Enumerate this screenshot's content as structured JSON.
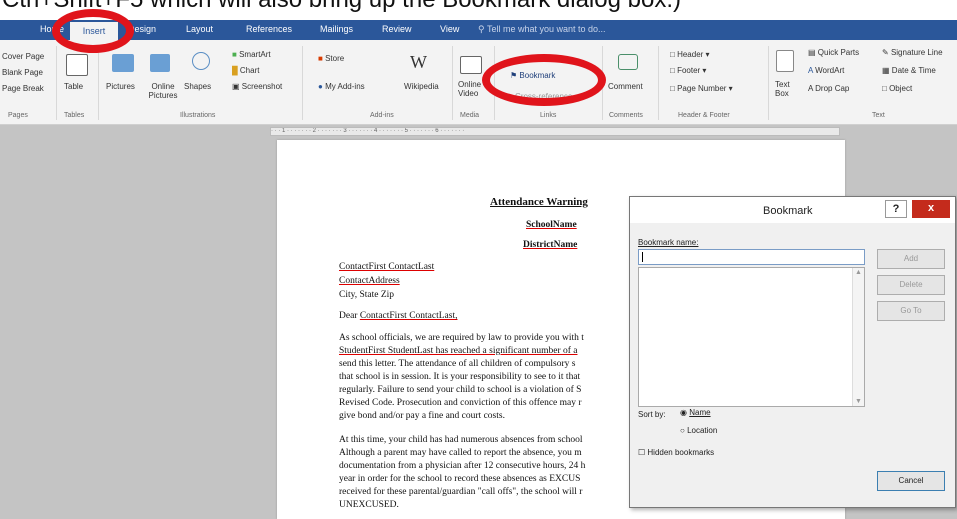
{
  "top_caption": "Ctrl+Shift+F5 which will also bring up the Bookmark dialog box.)",
  "tabs": [
    "Home",
    "Insert",
    "Design",
    "Layout",
    "References",
    "Mailings",
    "Review",
    "View"
  ],
  "tell_me": "Tell me what you want to do...",
  "ribbon": {
    "pages": [
      "Cover Page",
      "Blank Page",
      "Page Break"
    ],
    "table": "Table",
    "pictures": "Pictures",
    "online_pictures": "Online Pictures",
    "shapes": "Shapes",
    "smartart": "SmartArt",
    "chart": "Chart",
    "screenshot": "Screenshot",
    "store": "Store",
    "my_addins": "My Add-ins",
    "wikipedia": "Wikipedia",
    "online_video": "Online Video",
    "bookmark": "Bookmark",
    "cross_ref": "Cross-reference",
    "comment": "Comment",
    "header": "Header",
    "footer": "Footer",
    "page_number": "Page Number",
    "text_box": "Text Box",
    "quick_parts": "Quick Parts",
    "wordart": "WordArt",
    "drop_cap": "Drop Cap",
    "signature": "Signature Line",
    "date_time": "Date & Time",
    "object": "Object",
    "groups": [
      "Pages",
      "Tables",
      "Illustrations",
      "Add-ins",
      "Media",
      "Links",
      "Comments",
      "Header & Footer",
      "Text"
    ]
  },
  "document": {
    "title": "Attendance Warning",
    "school": "SchoolName",
    "district": "DistrictName",
    "addr1": "ContactFirst ContactLast",
    "addr2": "ContactAddress",
    "addr3": "City, State  Zip",
    "salutation_pre": "Dear ",
    "salutation_name": "ContactFirst ContactLast,",
    "p1": [
      "As school officials, we are required by law to provide you with t",
      "StudentFirst StudentLast has reached a significant number of a",
      "send this letter.   The attendance of all children of compulsory s",
      "that school is in session. It is your responsibility to see to it that",
      "regularly. Failure to send your child to school is a violation of S",
      "Revised Code. Prosecution and conviction of this offence may r",
      "give bond and/or pay a fine and court costs."
    ],
    "p2": [
      "At this time, your child has had numerous absences from school",
      "Although a parent may have called to report the absence, you m",
      "documentation from a physician after 12 consecutive hours, 24 h",
      "year in order for the school to record these absences as EXCUS",
      "received for these parental/guardian \"call offs\", the school will r",
      "UNEXCUSED."
    ]
  },
  "dialog": {
    "title": "Bookmark",
    "help": "?",
    "close": "x",
    "name_label": "Bookmark name:",
    "add": "Add",
    "delete": "Delete",
    "goto": "Go To",
    "sort_by": "Sort by:",
    "sort_name": "Name",
    "sort_location": "Location",
    "hidden": "Hidden bookmarks",
    "cancel": "Cancel"
  }
}
